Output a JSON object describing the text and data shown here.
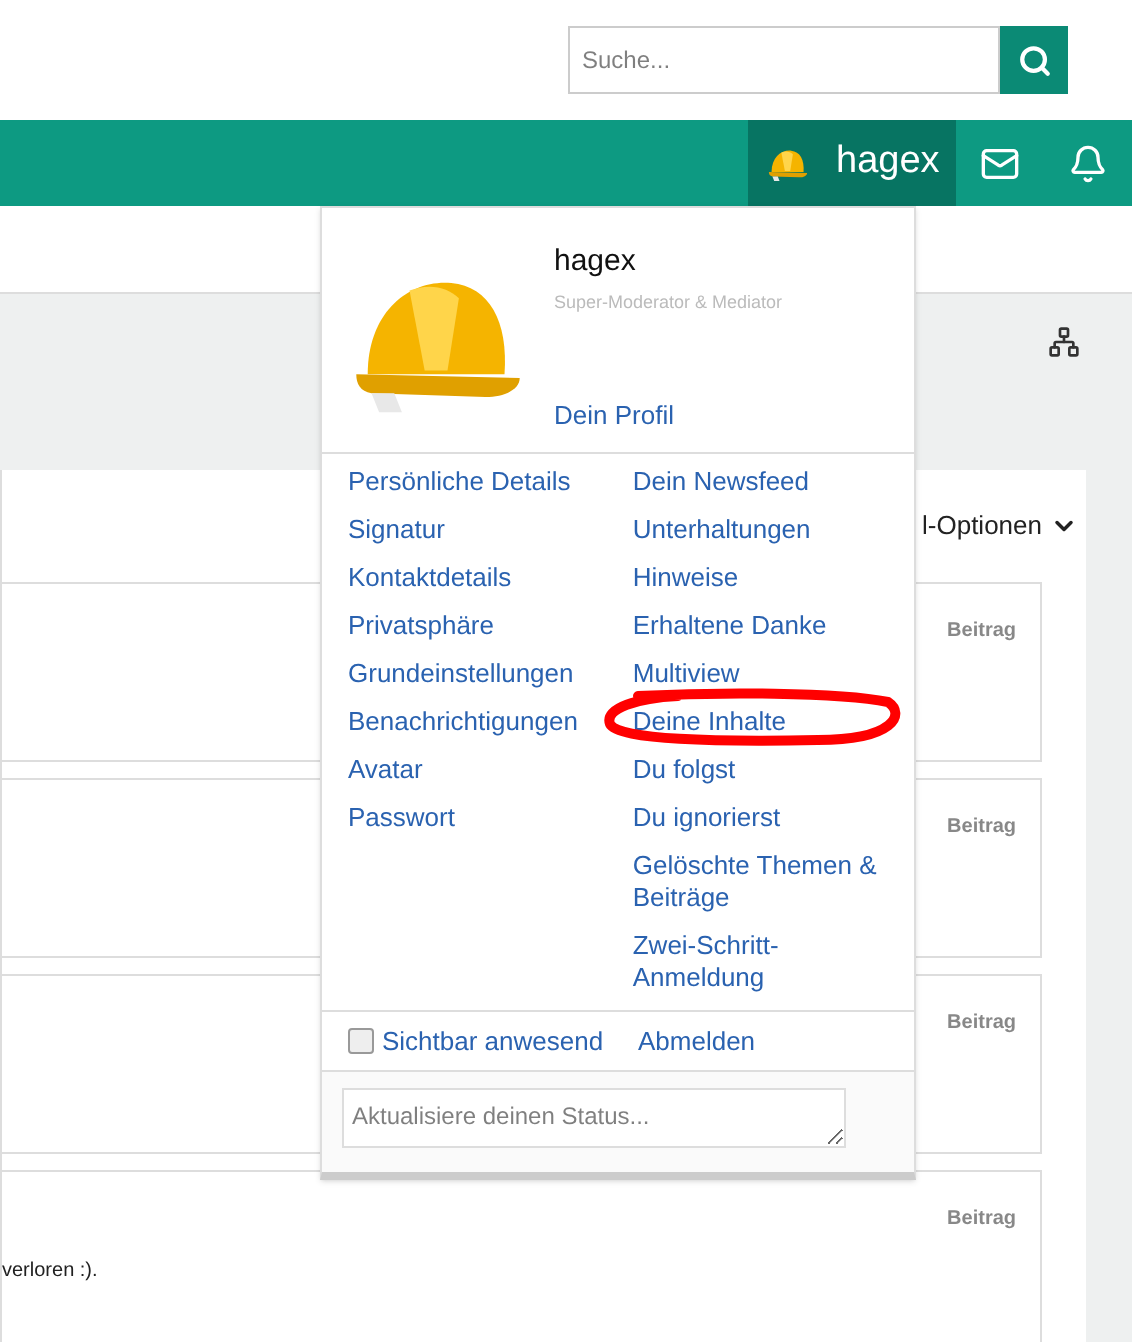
{
  "search": {
    "placeholder": "Suche..."
  },
  "navbar": {
    "user": "hagex"
  },
  "background": {
    "options_label": "l-Optionen",
    "posts": [
      {
        "type": "Beitrag"
      },
      {
        "type": "Beitrag"
      },
      {
        "type": "Beitrag"
      },
      {
        "type": "Beitrag",
        "excerpt": "verloren :)."
      }
    ]
  },
  "user_menu": {
    "name": "hagex",
    "role": "Super-Moderator & Mediator",
    "profile_link": "Dein Profil",
    "left_links": [
      "Persönliche Details",
      "Signatur",
      "Kontaktdetails",
      "Privatsphäre",
      "Grundeinstellungen",
      "Benachrichtigungen",
      "Avatar",
      "Passwort"
    ],
    "right_links": [
      "Dein Newsfeed",
      "Unterhaltungen",
      "Hinweise",
      "Erhaltene Danke",
      "Multiview",
      "Deine Inhalte",
      "Du folgst",
      "Du ignorierst",
      "Gelöschte Themen & Beiträge",
      "Zwei-Schritt-Anmeldung"
    ],
    "visible_online": {
      "label": "Sichtbar anwesend",
      "checked": false
    },
    "logout": "Abmelden",
    "status": {
      "placeholder": "Aktualisiere deinen Status..."
    }
  }
}
